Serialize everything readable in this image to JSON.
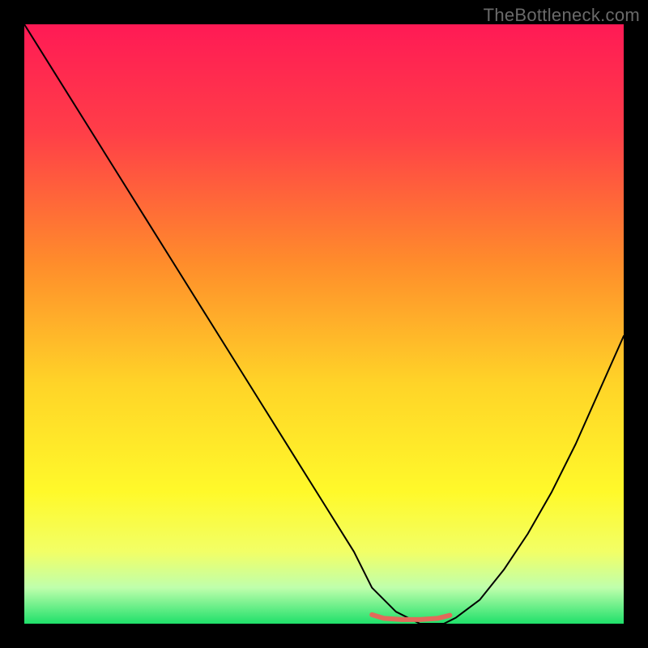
{
  "watermark": "TheBottleneck.com",
  "chart_data": {
    "type": "line",
    "title": "",
    "xlabel": "",
    "ylabel": "",
    "xlim": [
      0,
      100
    ],
    "ylim": [
      0,
      100
    ],
    "grid": false,
    "legend": false,
    "series": [
      {
        "name": "curve",
        "x": [
          0,
          5,
          10,
          15,
          20,
          25,
          30,
          35,
          40,
          45,
          50,
          55,
          58,
          62,
          66,
          70,
          72,
          76,
          80,
          84,
          88,
          92,
          96,
          100
        ],
        "y": [
          100,
          92,
          84,
          76,
          68,
          60,
          52,
          44,
          36,
          28,
          20,
          12,
          6,
          2,
          0,
          0,
          1,
          4,
          9,
          15,
          22,
          30,
          39,
          48
        ],
        "stroke": "#000000",
        "stroke_width": 2
      },
      {
        "name": "flat-red",
        "x": [
          58,
          60,
          63,
          66,
          69,
          71
        ],
        "y": [
          1.5,
          0.9,
          0.7,
          0.7,
          0.9,
          1.4
        ],
        "stroke": "#e26a5a",
        "stroke_width": 6
      }
    ],
    "background_gradient": {
      "stops": [
        {
          "offset": 0.0,
          "color": "#ff1a55"
        },
        {
          "offset": 0.18,
          "color": "#ff3e48"
        },
        {
          "offset": 0.4,
          "color": "#ff8d2b"
        },
        {
          "offset": 0.6,
          "color": "#ffd428"
        },
        {
          "offset": 0.78,
          "color": "#fff92a"
        },
        {
          "offset": 0.88,
          "color": "#f2ff66"
        },
        {
          "offset": 0.94,
          "color": "#bfffac"
        },
        {
          "offset": 1.0,
          "color": "#1fe06a"
        }
      ]
    }
  }
}
